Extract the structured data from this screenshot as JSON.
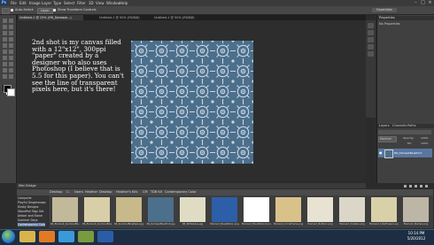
{
  "menubar": {
    "logo": "Ps",
    "items": [
      "File",
      "Edit",
      "Image",
      "Layer",
      "Type",
      "Select",
      "Filter",
      "3D",
      "View",
      "Window",
      "Help"
    ]
  },
  "options_bar": {
    "auto_select_label": "Auto-Select:",
    "auto_select_value": "Layer",
    "show_transform_label": "Show Transform Controls",
    "workspace": "Essentials"
  },
  "document_tabs": [
    {
      "label": "Untitled-1 @ 25% (R6_Damask...)",
      "active": true
    },
    {
      "label": "Untitled-1 @ 50% (RGB/8)",
      "active": false
    },
    {
      "label": "Untitled-1 @ 50% (RGB/8)",
      "active": false
    }
  ],
  "canvas": {
    "annotation": "2nd shot is my canvas filled with a 12\"x12\", 300ppi \"paper\" created by a designer who also uses Photoshop (I believe that is 5.5 for this paper).  You can't see the line of transparent pixels here, but it's there!",
    "paper_color": "#4c6f8c",
    "pattern_color": "#c9d6e2"
  },
  "panels": {
    "properties_title": "Properties",
    "properties_sub": "No Properties",
    "layers_tabs": [
      "Layers",
      "Channels",
      "Paths"
    ],
    "blend_mode": "Normal",
    "opacity_label": "Opacity:",
    "opacity_value": "100%",
    "fill_label": "Fill:",
    "fill_value": "100%",
    "layer_name": "R6_DamaskBluePrint"
  },
  "mini_bridge": {
    "title": "Mini Bridge",
    "path": [
      "Desktop",
      "C:",
      "Users",
      "Heather",
      "Desktop",
      "Heather's Kits",
      "CM",
      "TDB Kit",
      "Contemporary Color"
    ],
    "folders": [
      "Computer",
      "Playful Gingersnaps",
      "Kindly Designs",
      "Stonefish Tags Set",
      "Amber and Stone",
      "Summer Days",
      "Contemporary Colo"
    ],
    "thumbnails": [
      {
        "name": "R6_Element_SummerBlu...",
        "color": "#c2b89a"
      },
      {
        "name": "R6_Element_SummerBlue...",
        "color": "#d8cfa8"
      },
      {
        "name": "R6_SummerBluePaper.jpg",
        "color": "#c7b98a"
      },
      {
        "name": "R6_DamaskBluePrint.jpg",
        "color": "#4c6f8c"
      },
      {
        "name": "R6_Whitebase.jpg",
        "color": "#e0dcc4"
      },
      {
        "name": "Element_BlueRibbon.png",
        "color": "#2c5fa8"
      },
      {
        "name": "Element_BlueRibbon2.png",
        "color": "#ffffff"
      },
      {
        "name": "Element_CircleFrame.png",
        "color": "#d9c28a"
      },
      {
        "name": "Element_Button1.png",
        "color": "#e8e2d2"
      },
      {
        "name": "Element_Clusters.png",
        "color": "#dcd6c8"
      },
      {
        "name": "Element_CuteFlowers.png",
        "color": "#d7d0a8"
      },
      {
        "name": "Element_Stamps.png",
        "color": "#bdb6a6"
      }
    ]
  },
  "taskbar": {
    "time": "10:14 PM",
    "date": "5/20/2012",
    "apps": [
      {
        "name": "explorer",
        "color": "#d8b44a"
      },
      {
        "name": "media-player",
        "color": "#e07a25"
      },
      {
        "name": "chrome",
        "color": "#3a9ad9"
      },
      {
        "name": "files",
        "color": "#7a9b3c"
      },
      {
        "name": "photoshop",
        "color": "#2a5da8"
      }
    ]
  }
}
